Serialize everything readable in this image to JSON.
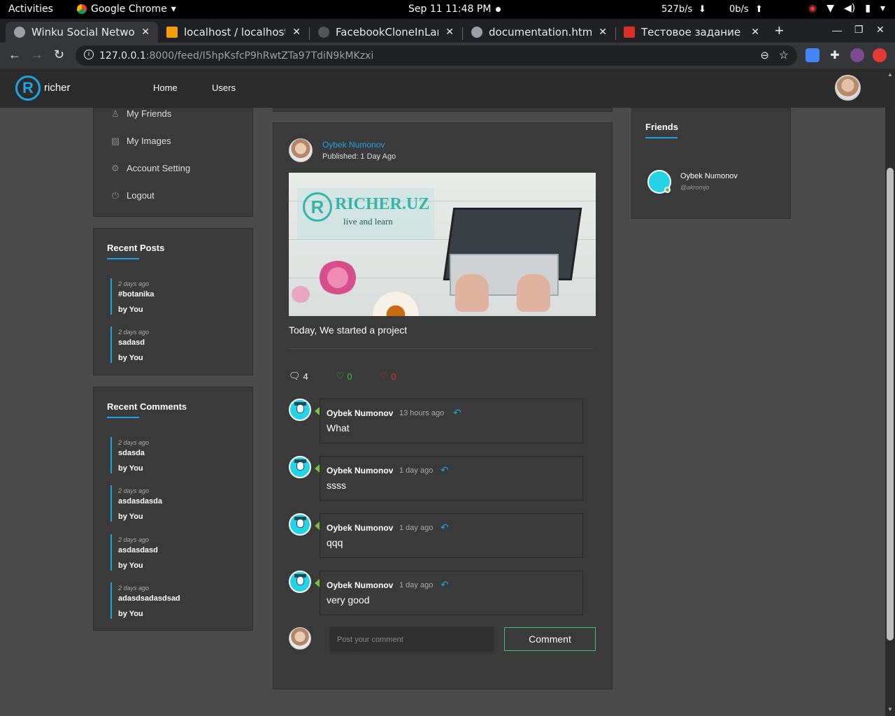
{
  "gnome": {
    "activities": "Activities",
    "app_name": "Google Chrome",
    "clock": "Sep 11  11:48 PM",
    "net_down": "527b/s",
    "net_up": "0b/s"
  },
  "tabs": [
    {
      "title": "Winku Social Network",
      "color": "#9aa0a6"
    },
    {
      "title": "localhost / localhost / l",
      "color": "#f89c0e"
    },
    {
      "title": "FacebookCloneInLarav",
      "color": "#555"
    },
    {
      "title": "documentation.html",
      "color": "#9aa0a6"
    },
    {
      "title": "Тестовое задание для",
      "color": "#d93025"
    }
  ],
  "address": {
    "host": "127.0.0.1",
    "path": ":8000/feed/I5hpKsfcP9hRwtZTa97TdiN9kMKzxi"
  },
  "site": {
    "logo_letter": "R",
    "logo_text": "richer",
    "nav": [
      "Home",
      "Users"
    ]
  },
  "sidebar": {
    "items": [
      {
        "label": "My Friends",
        "icon": "user-icon"
      },
      {
        "label": "My Images",
        "icon": "image-icon"
      },
      {
        "label": "Account Setting",
        "icon": "gear-icon"
      },
      {
        "label": "Logout",
        "icon": "power-icon"
      }
    ]
  },
  "recent_posts": {
    "title": "Recent Posts",
    "items": [
      {
        "when": "2 days ago",
        "what": "#botanika",
        "by": "by You"
      },
      {
        "when": "2 days ago",
        "what": "sadasd",
        "by": "by You"
      }
    ]
  },
  "recent_comments": {
    "title": "Recent Comments",
    "items": [
      {
        "when": "2 days ago",
        "what": "sdasda",
        "by": "by You"
      },
      {
        "when": "2 days ago",
        "what": "asdasdasda",
        "by": "by You"
      },
      {
        "when": "2 days ago",
        "what": "asdasdasd",
        "by": "by You"
      },
      {
        "when": "2 days ago",
        "what": "adasdsadasdsad",
        "by": "by You"
      }
    ]
  },
  "post": {
    "author": "Oybek Numonov",
    "published": "Published: 1 Day Ago",
    "image_brand": "RICHER.UZ",
    "image_tagline": "live and learn",
    "text": "Today, We started a project",
    "comments_count": "4",
    "likes": "0",
    "dislikes": "0",
    "comments": [
      {
        "name": "Oybek Numonov",
        "time": "13 hours ago",
        "text": "What"
      },
      {
        "name": "Oybek Numonov",
        "time": "1 day ago",
        "text": "ssss"
      },
      {
        "name": "Oybek Numonov",
        "time": "1 day ago",
        "text": "qqq"
      },
      {
        "name": "Oybek Numonov",
        "time": "1 day ago",
        "text": "very good"
      }
    ],
    "comment_placeholder": "Post your comment",
    "comment_button": "Comment"
  },
  "friends": {
    "title": "Friends",
    "items": [
      {
        "name": "Oybek Numonov",
        "handle": "@akromjo"
      }
    ]
  },
  "colors": {
    "accent": "#1fa2e0",
    "like": "#3fbf3f",
    "dislike": "#e0303a",
    "online": "#61c43a"
  }
}
